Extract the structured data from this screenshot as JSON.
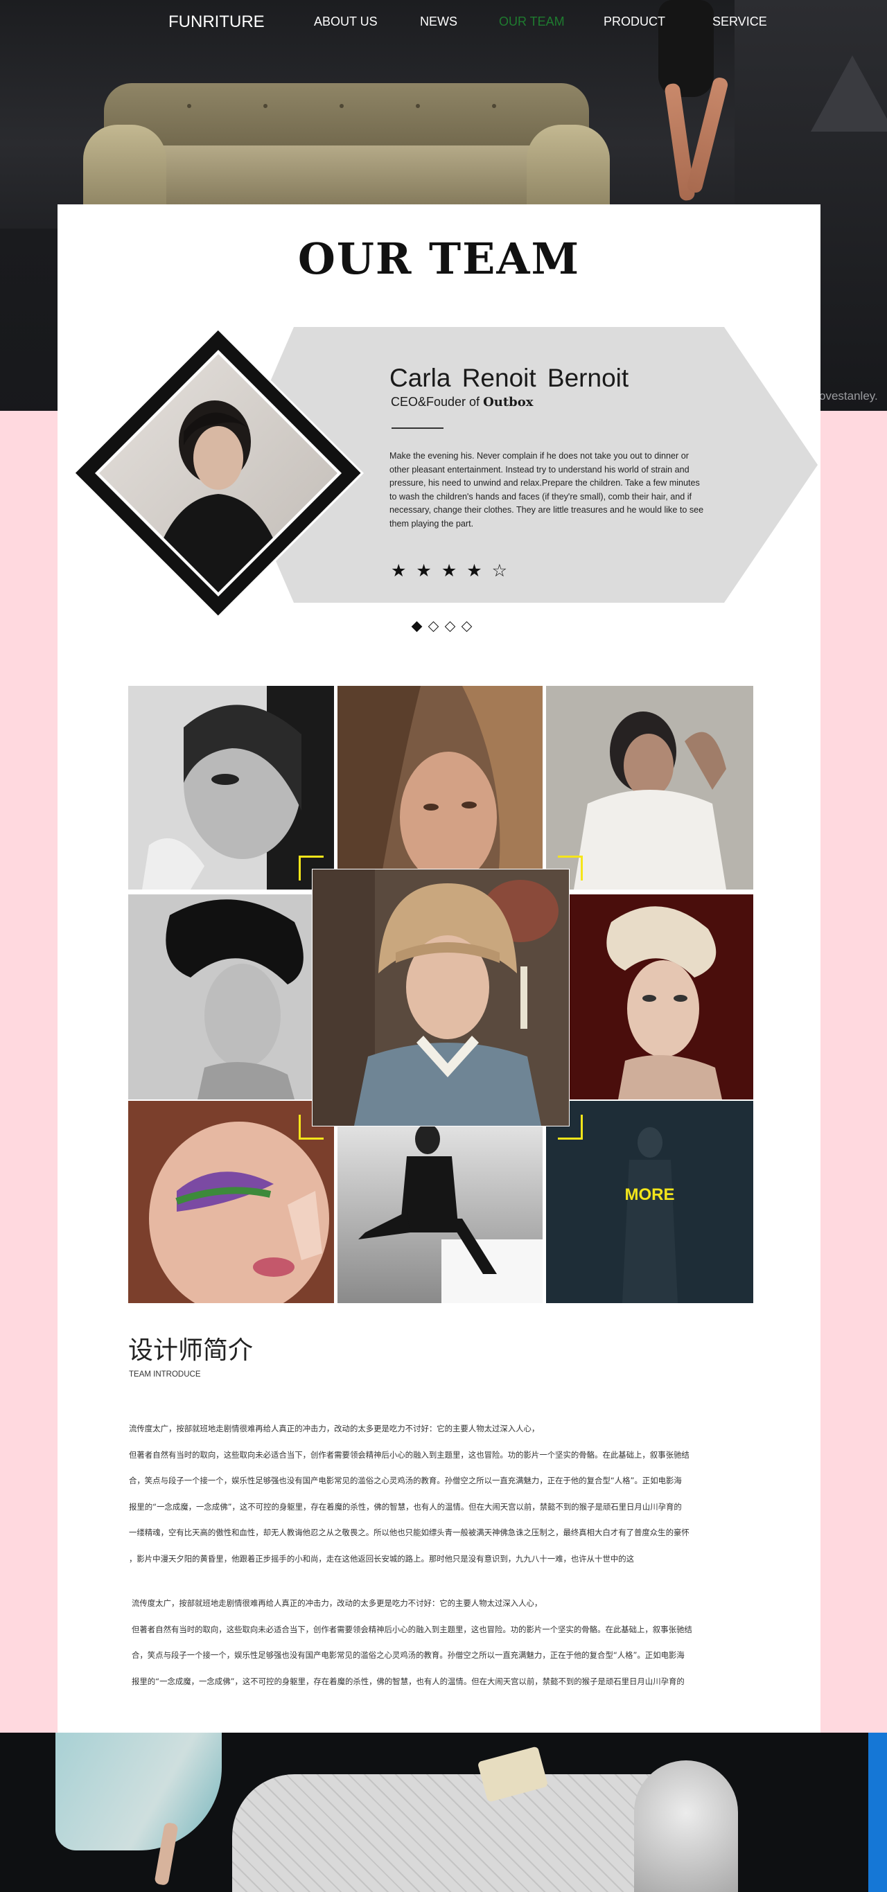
{
  "nav": {
    "logo": "FUNRITURE",
    "items": [
      {
        "label": "ABOUT US"
      },
      {
        "label": "NEWS"
      },
      {
        "label": "OUR TEAM",
        "active": true
      },
      {
        "label": "PRODUCT"
      },
      {
        "label": "SERVICE"
      }
    ]
  },
  "hero": {
    "watermark": "ovestanley."
  },
  "team": {
    "title": "OUR TEAM",
    "profile": {
      "name": "Carla  Renoit  Bernoit",
      "role_prefix": "CEO&Fouder of ",
      "company": "Outbox",
      "bio": "Make the evening his. Never complain if he does not take you out to dinner or other pleasant entertainment. Instead try to understand his world of strain and pressure, his need to unwind and relax.Prepare the children. Take a few minutes to wash the children's hands and faces (if they're small), comb their hair, and if necessary, change their clothes. They are little treasures and he would like to see them playing the part.",
      "rating": 4,
      "rating_max": 5,
      "stars_text": "★★★★☆"
    },
    "slider": {
      "count": 4,
      "active": 0
    }
  },
  "gallery": {
    "more_label": "MORE"
  },
  "intro": {
    "heading": "设计师简介",
    "subheading": "TEAM INTRODUCE",
    "paragraph1": [
      "流传度太广，按部就班地走剧情很难再给人真正的冲击力，改动的太多更是吃力不讨好：它的主要人物太过深入人心，",
      "但著者自然有当时的取向，这些取向未必适合当下，创作者需要领会精神后小心的融入到主题里，这也冒险。功的影片一个坚实的骨骼。在此基础上，叙事张驰结",
      "合，笑点与段子一个接一个，娱乐性足够强也没有国产电影常见的滥俗之心灵鸡汤的教育。孙僧空之所以一直充满魅力，正在于他的复合型“人格”。正如电影海",
      "报里的“一念成魔，一念成佛”，这不可控的身躯里，存在着魔的杀性，佛的智慧，也有人的温情。但在大闹天宫以前，禁懿不到的猴子是顽石里日月山川孕育的",
      "一缕精魂，空有比天高的傲性和血性，却无人教诲他忍之从之敬畏之。所以他也只能如缥头青一般被满天神佛急诛之压制之，最终真相大白才有了普度众生的豪怀",
      "，影片中漫天夕阳的黄昏里，他跟着正步摇手的小和尚，走在这他返回长安城的路上。那时他只是没有意识到，九九八十一难，也许从十世中的这"
    ],
    "paragraph2": [
      "流传度太广，按部就班地走剧情很难再给人真正的冲击力，改动的太多更是吃力不讨好：它的主要人物太过深入人心，",
      "但著者自然有当时的取向，这些取向未必适合当下，创作者需要领会精神后小心的融入到主题里，这也冒险。功的影片一个坚实的骨骼。在此基础上，叙事张驰结",
      "合，笑点与段子一个接一个，娱乐性足够强也没有国产电影常见的滥俗之心灵鸡汤的教育。孙僧空之所以一直充满魅力，正在于他的复合型“人格”。正如电影海",
      "报里的“一念成魔，一念成佛”，这不可控的身躯里，存在着魔的杀性，佛的智慧，也有人的温情。但在大闹天宫以前，禁懿不到的猴子是顽石里日月山川孕育的"
    ]
  },
  "colors": {
    "nav_active": "#1e7b2f",
    "banner_gray": "#dcdcdc",
    "accent_yellow": "#f2e51b",
    "page_pink": "#ffd9df",
    "footer_blue": "#1577d6"
  }
}
